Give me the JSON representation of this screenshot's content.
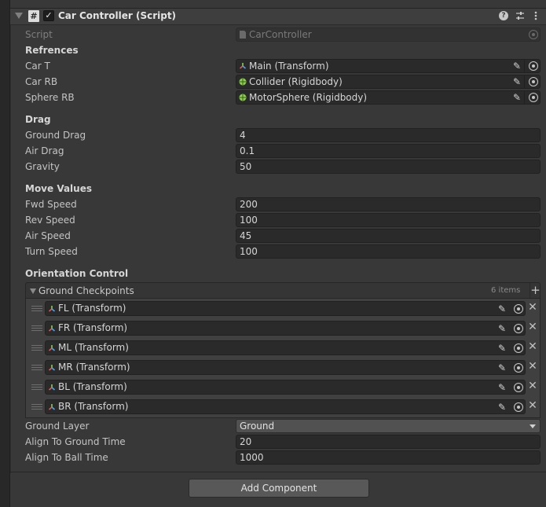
{
  "component": {
    "title": "Car Controller (Script)",
    "enabled_check": "✓"
  },
  "script_field": {
    "label": "Script",
    "value": "CarController"
  },
  "sections": {
    "refs": "Refrences",
    "drag": "Drag",
    "move": "Move Values",
    "orientation": "Orientation Control"
  },
  "refs": [
    {
      "label": "Car T",
      "value": "Main (Transform)",
      "icon": "transform-icon"
    },
    {
      "label": "Car RB",
      "value": "Collider (Rigidbody)",
      "icon": "rigidbody-icon"
    },
    {
      "label": "Sphere RB",
      "value": "MotorSphere (Rigidbody)",
      "icon": "rigidbody-icon"
    }
  ],
  "drag": [
    {
      "label": "Ground Drag",
      "value": "4"
    },
    {
      "label": "Air Drag",
      "value": "0.1"
    },
    {
      "label": "Gravity",
      "value": "50"
    }
  ],
  "move": [
    {
      "label": "Fwd Speed",
      "value": "200"
    },
    {
      "label": "Rev Speed",
      "value": "100"
    },
    {
      "label": "Air Speed",
      "value": "45"
    },
    {
      "label": "Turn Speed",
      "value": "100"
    }
  ],
  "checkpoints": {
    "title": "Ground Checkpoints",
    "count": "6 items",
    "items": [
      "FL (Transform)",
      "FR (Transform)",
      "ML (Transform)",
      "MR (Transform)",
      "BL (Transform)",
      "BR (Transform)"
    ]
  },
  "ground_layer": {
    "label": "Ground Layer",
    "value": "Ground"
  },
  "align": [
    {
      "label": "Align To Ground Time",
      "value": "20"
    },
    {
      "label": "Align To Ball Time",
      "value": "1000"
    }
  ],
  "add_component": "Add Component",
  "colors": {
    "panel": "#383838",
    "field": "#2a2a2a",
    "rigidbody_icon": "#8bd14b",
    "transform_red": "#e2564f",
    "transform_green": "#8bd14b",
    "transform_blue": "#4aa3f0"
  }
}
